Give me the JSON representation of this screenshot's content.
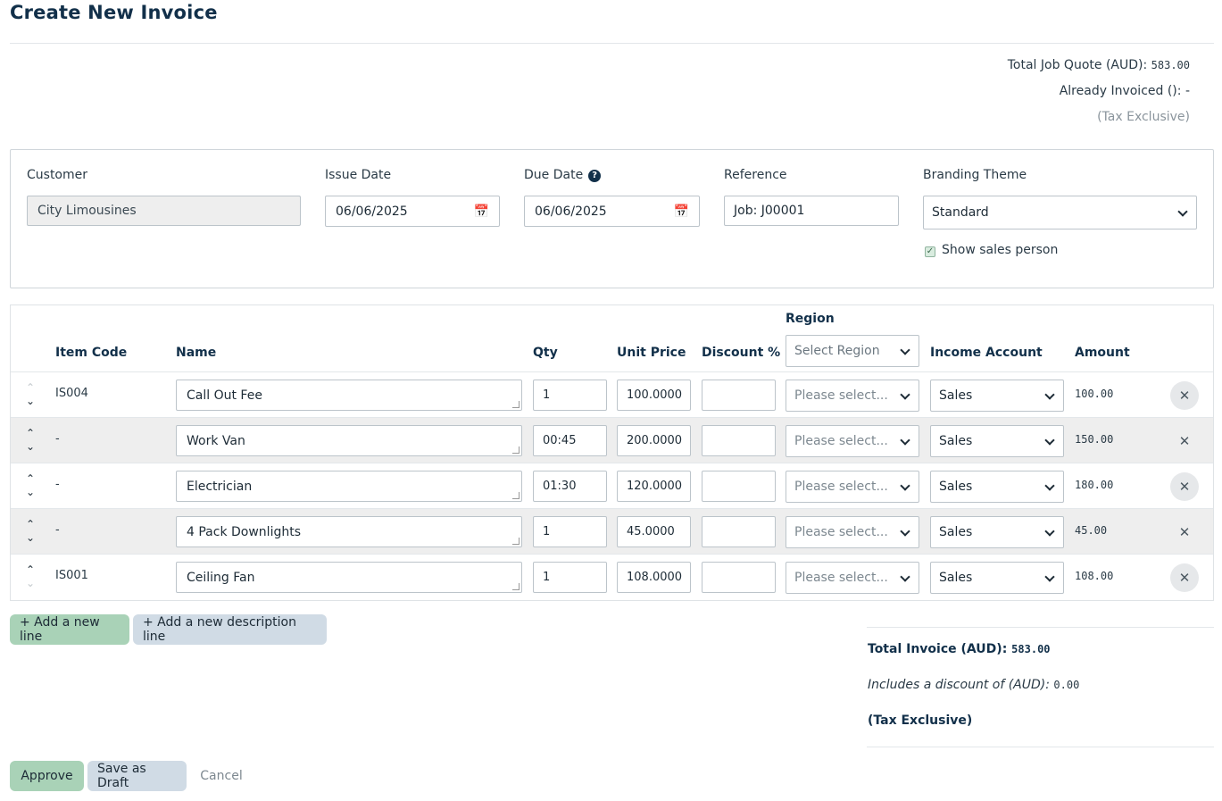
{
  "page": {
    "title": "Create New Invoice"
  },
  "quote_summary": {
    "total_job_quote_label": "Total Job Quote (AUD):",
    "total_job_quote_value": "583.00",
    "already_invoiced_label": "Already Invoiced ():",
    "already_invoiced_value": "-",
    "tax_note": "(Tax Exclusive)"
  },
  "header": {
    "customer_label": "Customer",
    "customer_value": "City Limousines",
    "issue_date_label": "Issue Date",
    "issue_date_value": "06/06/2025",
    "due_date_label": "Due Date",
    "due_date_value": "06/06/2025",
    "reference_label": "Reference",
    "reference_value": "Job: J00001",
    "branding_label": "Branding Theme",
    "branding_value": "Standard",
    "show_sales_person_label": "Show sales person",
    "show_sales_person_checked": true
  },
  "table": {
    "columns": {
      "item_code": "Item Code",
      "name": "Name",
      "qty": "Qty",
      "unit_price": "Unit Price",
      "discount": "Discount %",
      "region": "Region",
      "income_account": "Income Account",
      "amount": "Amount"
    },
    "region_filter_placeholder": "Select Region",
    "rows": [
      {
        "item_code": "IS004",
        "name": "Call Out Fee",
        "qty": "1",
        "unit_price": "100.0000",
        "discount": "",
        "region": "Please select...",
        "income_account": "Sales",
        "amount": "100.00"
      },
      {
        "item_code": "-",
        "name": "Work Van",
        "qty": "00:45",
        "unit_price": "200.0000",
        "discount": "",
        "region": "Please select...",
        "income_account": "Sales",
        "amount": "150.00"
      },
      {
        "item_code": "-",
        "name": "Electrician",
        "qty": "01:30",
        "unit_price": "120.0000",
        "discount": "",
        "region": "Please select...",
        "income_account": "Sales",
        "amount": "180.00"
      },
      {
        "item_code": "-",
        "name": "4 Pack Downlights",
        "qty": "1",
        "unit_price": "45.0000",
        "discount": "",
        "region": "Please select...",
        "income_account": "Sales",
        "amount": "45.00"
      },
      {
        "item_code": "IS001",
        "name": "Ceiling Fan",
        "qty": "1",
        "unit_price": "108.0000",
        "discount": "",
        "region": "Please select...",
        "income_account": "Sales",
        "amount": "108.00"
      }
    ]
  },
  "actions": {
    "add_line": "+ Add a new line",
    "add_description_line": "+ Add a new description line",
    "approve": "Approve",
    "save_draft": "Save as Draft",
    "cancel": "Cancel"
  },
  "totals": {
    "total_invoice_label": "Total Invoice (AUD):",
    "total_invoice_value": "583.00",
    "discount_label": "Includes a discount of (AUD):",
    "discount_value": "0.00",
    "tax_note": "(Tax Exclusive)"
  },
  "icons": {
    "calendar": "calendar-icon",
    "chevron": "chevron-down-icon",
    "help": "help-icon",
    "remove": "close-icon"
  },
  "colors": {
    "title": "#12304a",
    "primary_button": "#a9d2b7",
    "secondary_button": "#d0dbe5",
    "alt_row": "#eeeeee"
  }
}
